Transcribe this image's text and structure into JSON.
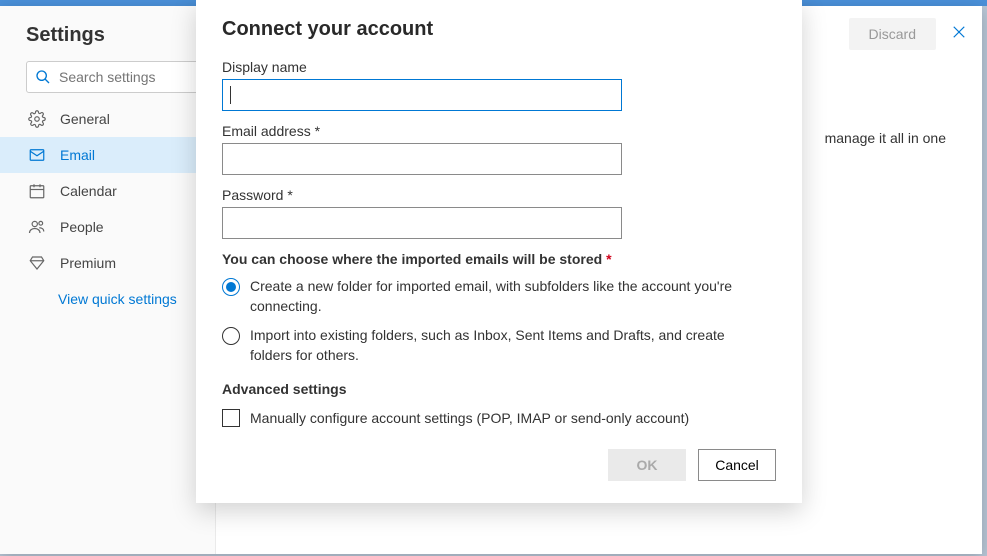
{
  "settings": {
    "title": "Settings",
    "search_placeholder": "Search settings",
    "nav": [
      {
        "label": "General"
      },
      {
        "label": "Email"
      },
      {
        "label": "Calendar"
      },
      {
        "label": "People"
      },
      {
        "label": "Premium"
      }
    ],
    "quick_link": "View quick settings"
  },
  "header": {
    "discard": "Discard"
  },
  "bg": {
    "snippet": "manage it all in one"
  },
  "dialog": {
    "title": "Connect your account",
    "display_name": {
      "label": "Display name",
      "value": ""
    },
    "email": {
      "label": "Email address *",
      "value": ""
    },
    "password": {
      "label": "Password *",
      "value": ""
    },
    "storage_heading": "You can choose where the imported emails will be stored ",
    "storage_asterisk": "*",
    "radio1": "Create a new folder for imported email, with subfolders like the account you're connecting.",
    "radio2": "Import into existing folders, such as Inbox, Sent Items and Drafts, and create folders for others.",
    "advanced": "Advanced settings",
    "manual_check": "Manually configure account settings (POP, IMAP or send-only account)",
    "ok": "OK",
    "cancel": "Cancel"
  }
}
